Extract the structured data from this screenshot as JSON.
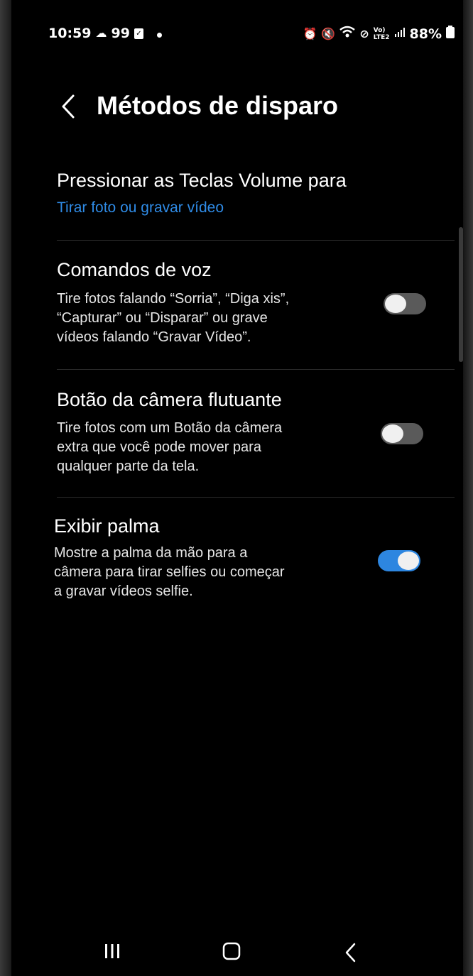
{
  "status_bar": {
    "time": "10:59",
    "notif_count": "99",
    "battery": "88%",
    "icons_left": [
      "cloud-icon",
      "check-box-icon"
    ],
    "icons_right": [
      "alarm-icon",
      "mute-icon",
      "wifi-icon",
      "no-disturb-icon",
      "volte-icon",
      "signal-icon",
      "battery-icon"
    ]
  },
  "header": {
    "title": "Métodos de disparo",
    "back_icon": "chevron-left-icon"
  },
  "items": [
    {
      "title": "Pressionar as Teclas Volume para",
      "link": "Tirar foto ou gravar vídeo"
    },
    {
      "title": "Comandos de voz",
      "desc_lines": [
        "Tire fotos falando “Sorria”, “Diga xis”,",
        "“Capturar” ou “Disparar” ou grave",
        "vídeos falando “Gravar Vídeo”."
      ],
      "toggle_on": false
    },
    {
      "title": "Botão da câmera flutuante",
      "desc_lines": [
        "Tire fotos com um Botão da câmera",
        "extra que você pode mover para",
        "qualquer parte da tela."
      ],
      "toggle_on": false
    },
    {
      "title": "Exibir palma",
      "desc_lines": [
        "Mostre a palma da mão para a",
        "câmera para tirar selfies ou começar",
        "a gravar vídeos selfie."
      ],
      "toggle_on": true
    }
  ],
  "nav_bar": {
    "recents_icon": "recents-icon",
    "home_icon": "home-icon",
    "back_icon": "back-icon"
  },
  "colors": {
    "accent": "#2d86e0",
    "link": "#2f8be6",
    "background": "#000000"
  }
}
